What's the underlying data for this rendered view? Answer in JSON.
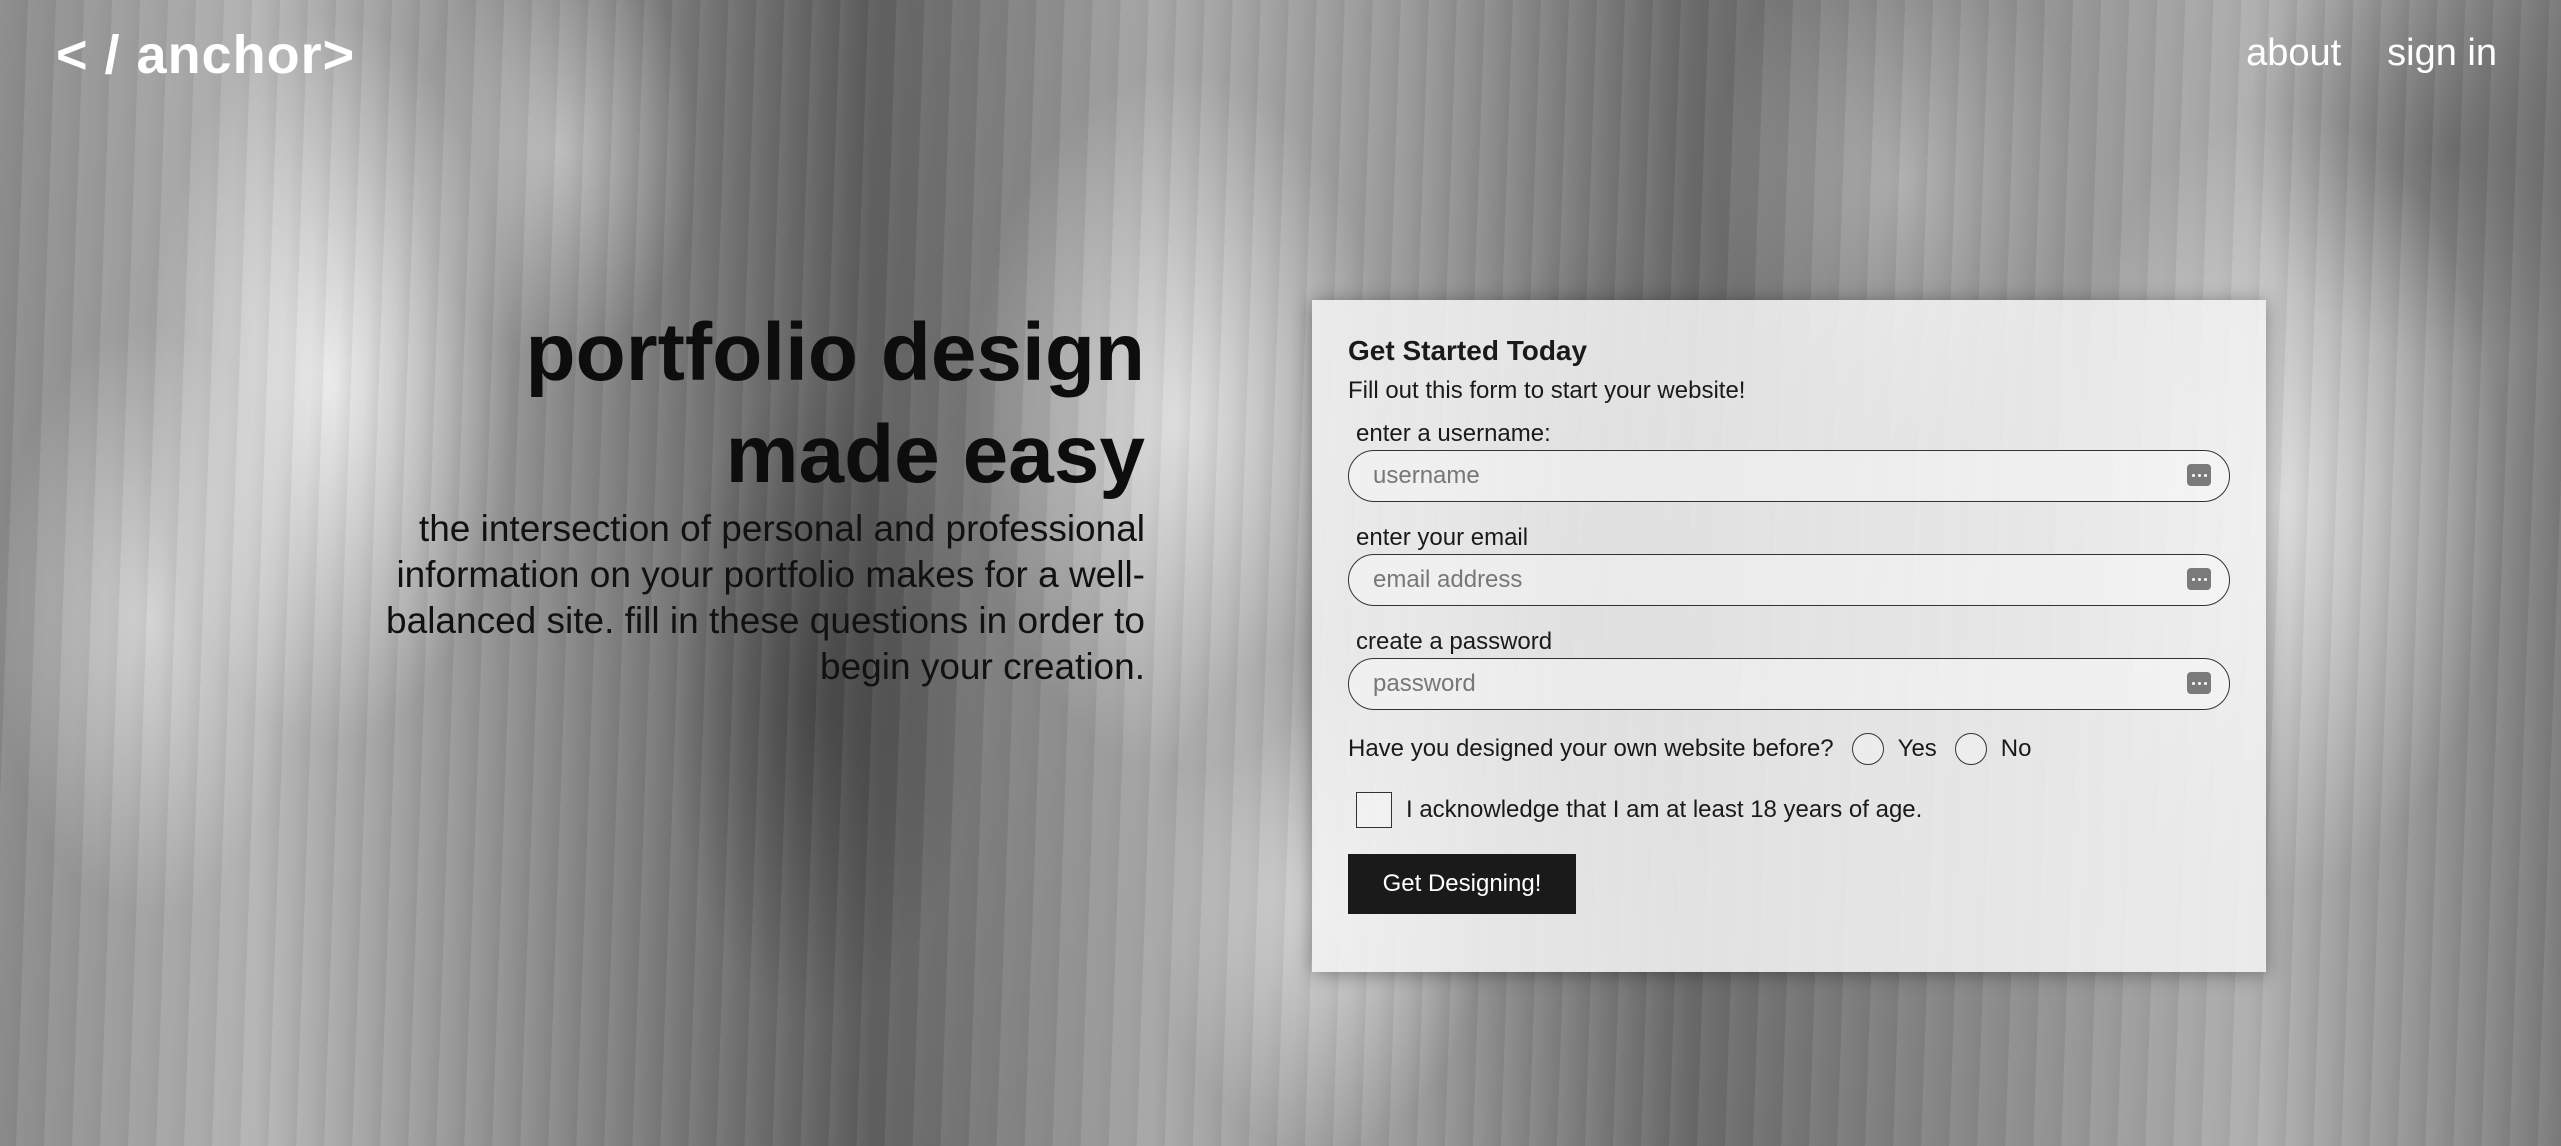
{
  "header": {
    "logo": "< / anchor>",
    "nav": [
      {
        "label": "about"
      },
      {
        "label": "sign in"
      }
    ]
  },
  "hero": {
    "title_line1": "portfolio design",
    "title_line2": "made easy",
    "description": "the intersection of personal and professional information on your portfolio makes for a well-balanced site. fill in these questions in order to begin your creation."
  },
  "form": {
    "title": "Get Started Today",
    "subtitle": "Fill out this form to start your website!",
    "username": {
      "label": "enter a username:",
      "placeholder": "username",
      "value": ""
    },
    "email": {
      "label": "enter your email",
      "placeholder": "email address",
      "value": ""
    },
    "password": {
      "label": "create a password",
      "placeholder": "password",
      "value": ""
    },
    "question": "Have you designed your own website before?",
    "options": [
      {
        "label": "Yes",
        "selected": false
      },
      {
        "label": "No",
        "selected": false
      }
    ],
    "acknowledge": "I acknowledge that I am at least 18 years of age.",
    "acknowledge_checked": false,
    "submit_label": "Get Designing!"
  },
  "icons": {
    "field_icon": "password-manager-icon"
  },
  "colors": {
    "button_bg": "#1a1a1a",
    "text_dark": "#111111",
    "header_text": "#ffffff"
  }
}
